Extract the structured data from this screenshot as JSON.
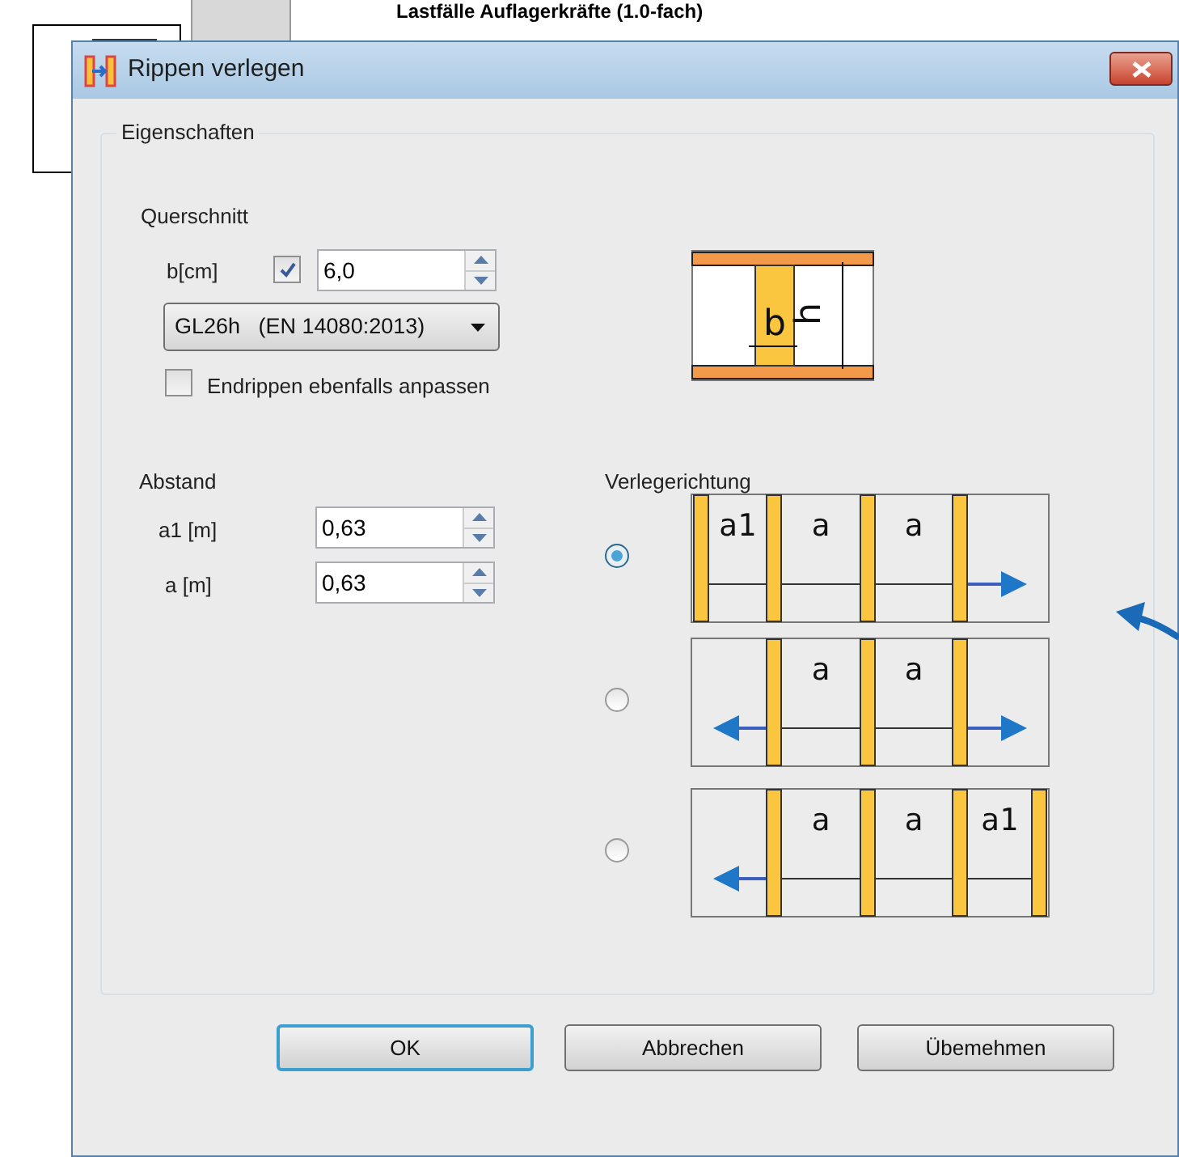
{
  "background": {
    "heading": "Lastfälle Auflagerkräfte (1.0-fach)"
  },
  "window": {
    "title": "Rippen verlegen"
  },
  "group": {
    "title": "Eigenschaften"
  },
  "cross_section": {
    "title": "Querschnitt",
    "width_label": "b[cm]",
    "width_checked": true,
    "width_value": "6,0",
    "material": "GL26h   (EN 14080:2013)",
    "end_ribs": {
      "label": "Endrippen ebenfalls anpassen",
      "checked": false
    },
    "diagram_labels": [
      "b",
      "h"
    ]
  },
  "spacing": {
    "title": "Abstand",
    "fields": [
      {
        "label": "a1 [m]",
        "value": "0,63"
      },
      {
        "label": "a [m]",
        "value": "0,63"
      }
    ]
  },
  "direction": {
    "title": "Verlegerichtung",
    "options": [
      {
        "selected": true,
        "left_end_rib": true,
        "right_end_rib": false,
        "left_arrow": false,
        "right_arrow": true,
        "labels": [
          "a1",
          "a",
          "a"
        ]
      },
      {
        "selected": false,
        "left_end_rib": false,
        "right_end_rib": false,
        "left_arrow": true,
        "right_arrow": true,
        "labels": [
          "a",
          "a"
        ]
      },
      {
        "selected": false,
        "left_end_rib": false,
        "right_end_rib": true,
        "left_arrow": true,
        "right_arrow": false,
        "labels": [
          "a",
          "a",
          "a1"
        ]
      }
    ]
  },
  "buttons": [
    {
      "label": "OK",
      "default": true
    },
    {
      "label": "Abbrechen",
      "default": false
    },
    {
      "label": "Übemehmen",
      "default": false
    }
  ]
}
